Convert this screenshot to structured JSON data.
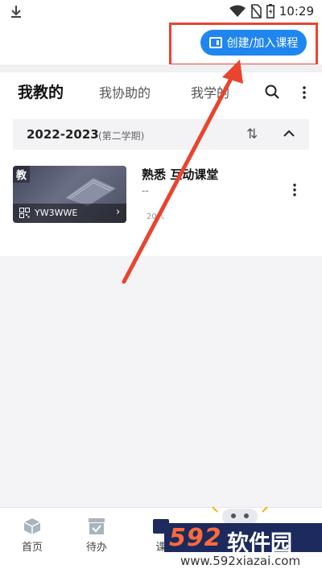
{
  "status_bar": {
    "time": "10:29"
  },
  "header": {
    "create_join_label": "创建/加入课程"
  },
  "tabs": [
    {
      "label": "我教的",
      "active": true
    },
    {
      "label": "我协助的",
      "active": false
    },
    {
      "label": "我学的",
      "active": false
    }
  ],
  "term": {
    "year": "2022-2023",
    "semester": "(第二学期)"
  },
  "course": {
    "badge": "教",
    "code": "YW3WWE",
    "title": "熟悉 互动课堂",
    "subtitle": "--",
    "count": "20人"
  },
  "bottom_nav": [
    {
      "label": "首页"
    },
    {
      "label": "待办"
    },
    {
      "label": "课"
    }
  ],
  "watermark": {
    "brand_number": "592",
    "brand_text": "软件园",
    "url": "www.592xiazai.com"
  },
  "colors": {
    "accent": "#1f86f0",
    "annotation": "#e9442f"
  }
}
